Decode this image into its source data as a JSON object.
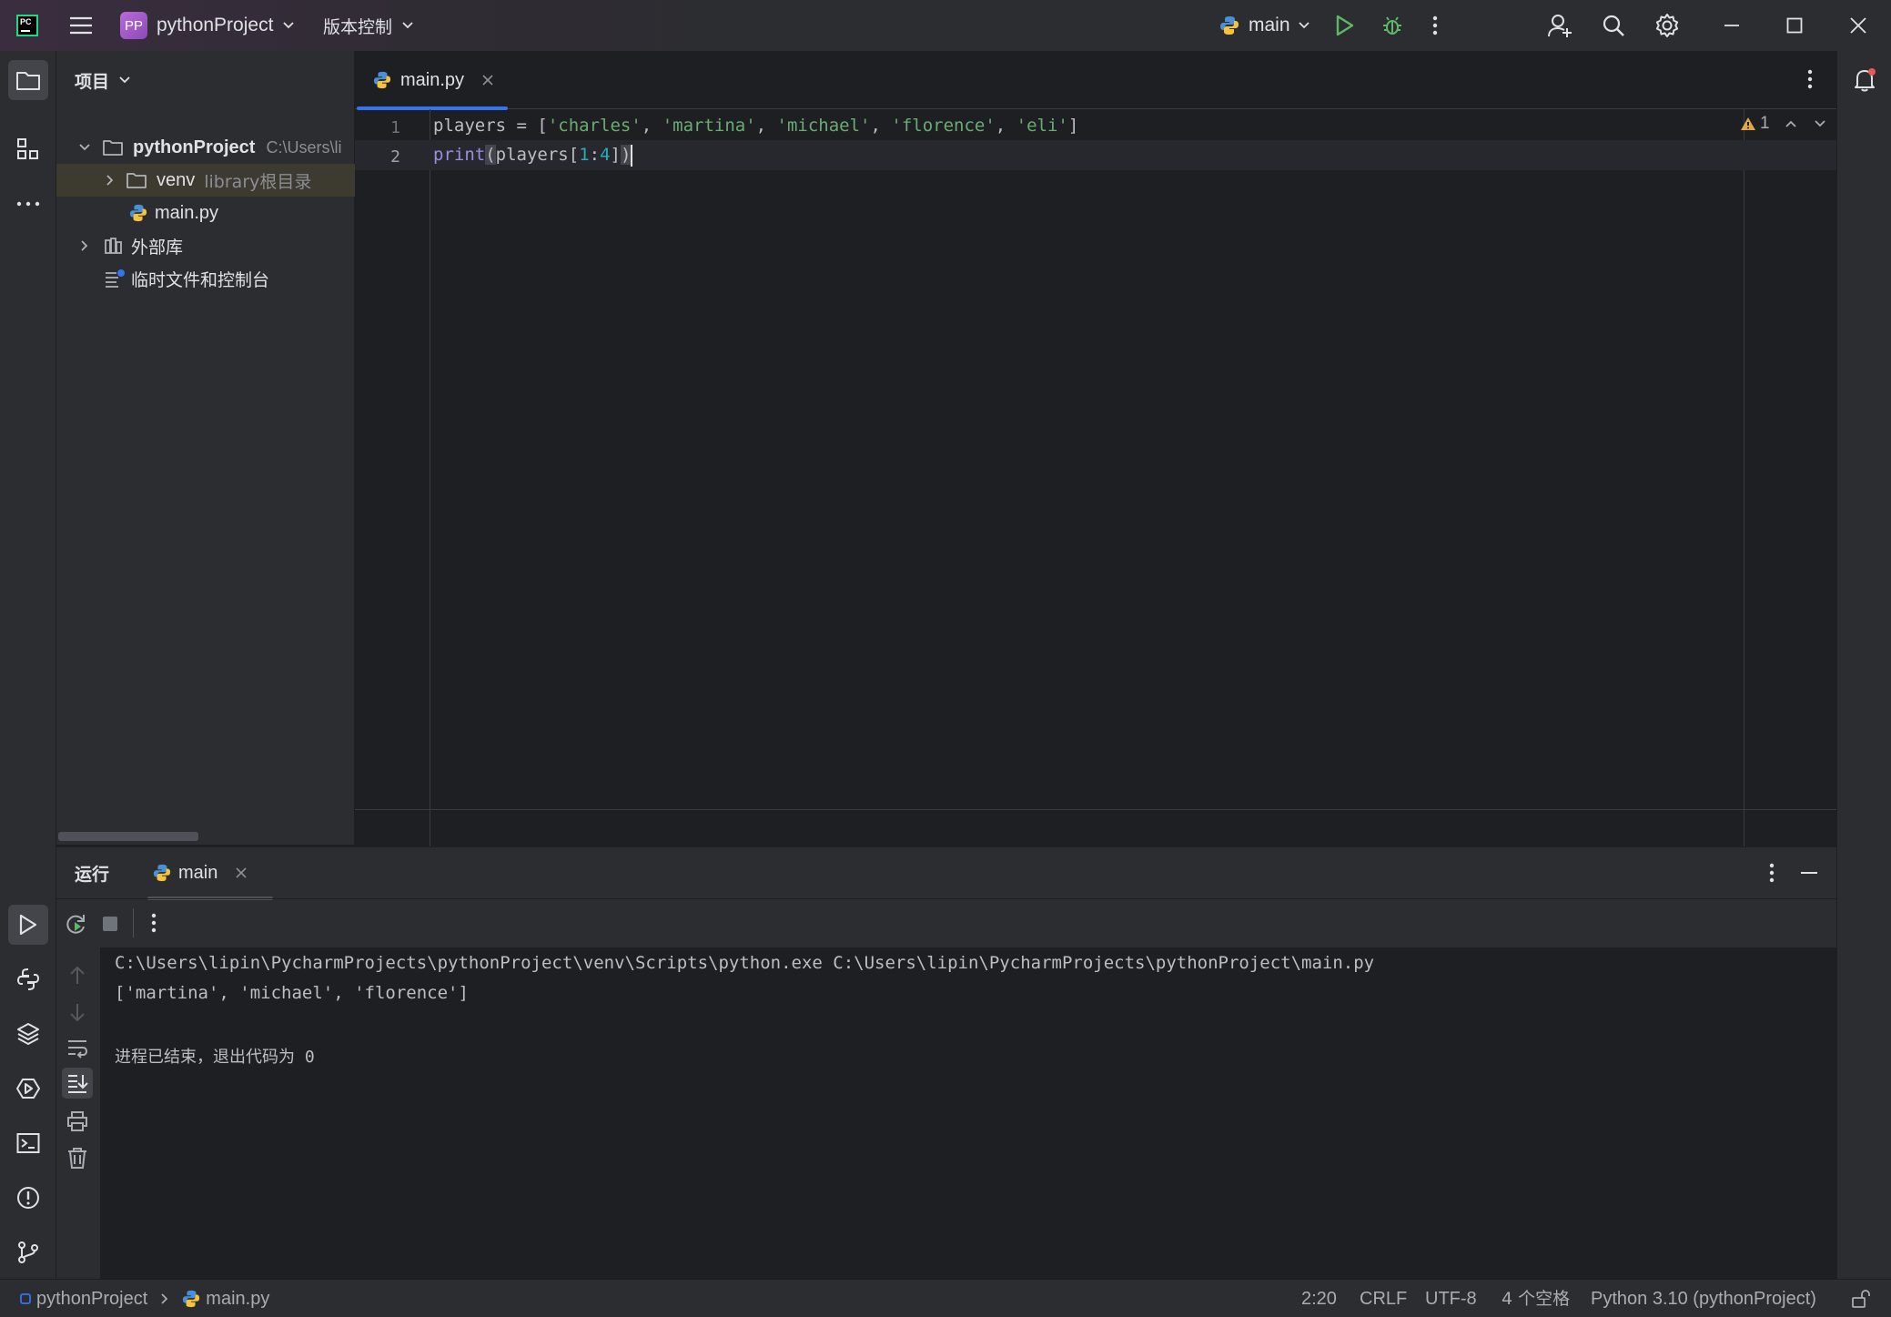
{
  "titlebar": {
    "app_logo": "PC",
    "project_badge": "PP",
    "project_name": "pythonProject",
    "vcs_label": "版本控制",
    "run_config": "main"
  },
  "project_panel": {
    "title": "项目",
    "items": [
      {
        "label": "pythonProject",
        "hint": "C:\\Users\\li"
      },
      {
        "label": "venv",
        "hint": "library根目录"
      },
      {
        "label": "main.py",
        "hint": ""
      },
      {
        "label": "外部库",
        "hint": ""
      },
      {
        "label": "临时文件和控制台",
        "hint": ""
      }
    ]
  },
  "editor": {
    "tab_label": "main.py",
    "warnings_count": "1",
    "line_numbers": [
      "1",
      "2"
    ],
    "line1": {
      "var": "players",
      "op": " = [",
      "s1": "'charles'",
      "s2": "'martina'",
      "s3": "'michael'",
      "s4": "'florence'",
      "s5": "'eli'",
      "sep": ", ",
      "close": "]"
    },
    "line2": {
      "fn": "print",
      "open": "(",
      "var": "players",
      "lb": "[",
      "n1": "1",
      "colon": ":",
      "n2": "4",
      "rb": "]",
      "close": ")"
    }
  },
  "run_panel": {
    "title": "运行",
    "tab_label": "main",
    "console": [
      "C:\\Users\\lipin\\PycharmProjects\\pythonProject\\venv\\Scripts\\python.exe C:\\Users\\lipin\\PycharmProjects\\pythonProject\\main.py",
      "['martina', 'michael', 'florence']",
      "",
      "进程已结束，退出代码为 0"
    ]
  },
  "statusbar": {
    "breadcrumb_project": "pythonProject",
    "breadcrumb_file": "main.py",
    "cursor_position": "2:20",
    "line_ending": "CRLF",
    "encoding": "UTF-8",
    "indent": "4 个空格",
    "interpreter": "Python 3.10 (pythonProject)"
  },
  "colors": {
    "accent": "#3574f0",
    "run_green": "#5fb865",
    "string": "#6aab73",
    "keyword": "#c77dbb",
    "number": "#2aacb8",
    "warning": "#e0a74a"
  }
}
